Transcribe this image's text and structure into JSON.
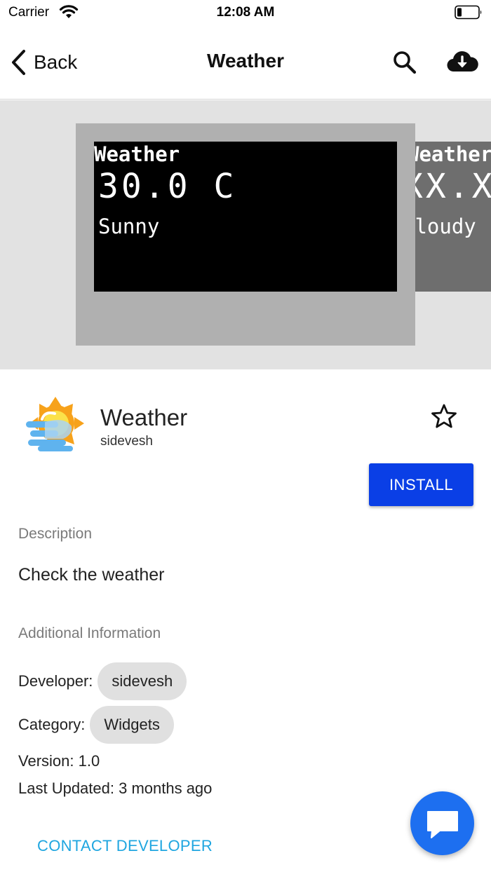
{
  "status_bar": {
    "carrier": "Carrier",
    "time": "12:08 AM"
  },
  "nav": {
    "back_label": "Back",
    "title": "Weather",
    "icons": [
      "chevron-left-icon",
      "search-icon",
      "cloud-download-icon"
    ]
  },
  "gallery": {
    "screenshots": [
      {
        "title": "Weather",
        "temp": "30.0 C",
        "condition": "Sunny"
      },
      {
        "title": "Weather",
        "temp": "XX.X",
        "condition": "Cloudy"
      }
    ]
  },
  "app": {
    "name": "Weather",
    "developer": "sidevesh",
    "install_label": "INSTALL",
    "icon": "weather-app-icon",
    "favorite_icon": "star-outline-icon"
  },
  "description": {
    "label": "Description",
    "text": "Check the weather"
  },
  "additional_info": {
    "label": "Additional Information",
    "developer_label": "Developer:",
    "developer_value": "sidevesh",
    "category_label": "Category:",
    "category_value": "Widgets",
    "version": "Version: 1.0",
    "last_updated": "Last Updated: 3 months ago"
  },
  "contact_label": "CONTACT DEVELOPER",
  "fab_icon": "chat-icon",
  "colors": {
    "install_button": "#0a3fe6",
    "contact_link": "#1fa6e0",
    "fab": "#1d6ff0",
    "gallery_bg": "#e2e2e2",
    "chip_bg": "#e0e0e0"
  }
}
